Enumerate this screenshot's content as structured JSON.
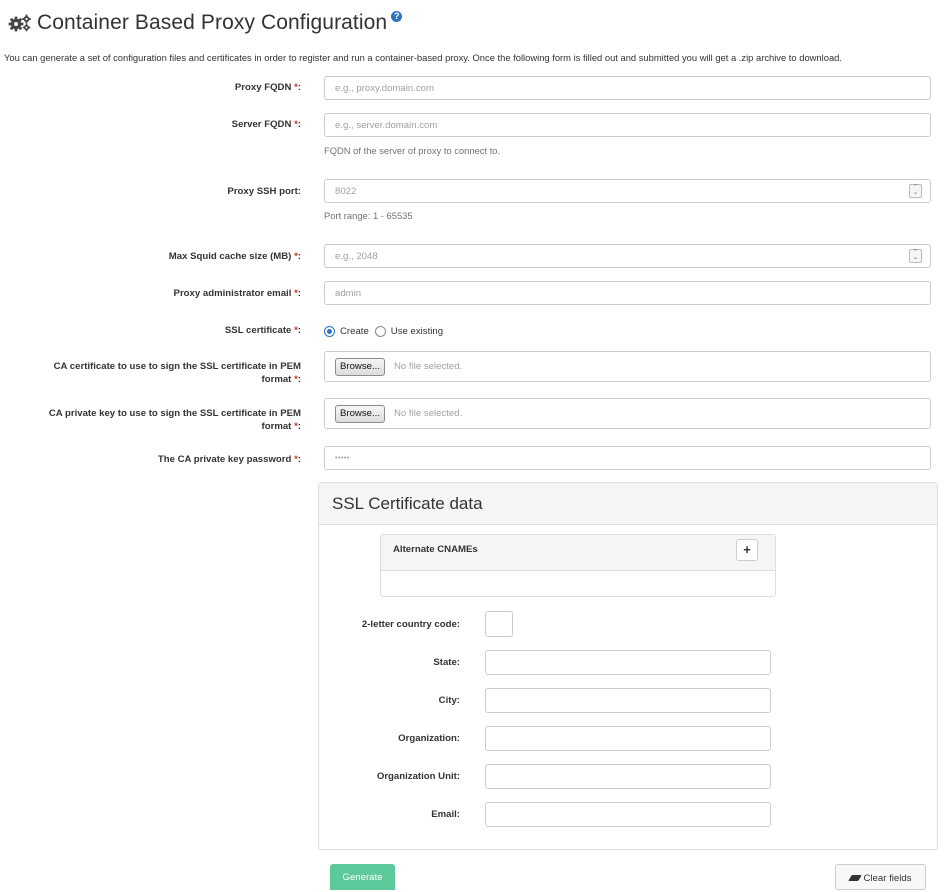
{
  "page": {
    "title": "Container Based Proxy Configuration",
    "help_icon_glyph": "?",
    "description": "You can generate a set of configuration files and certificates in order to register and run a container-based proxy. Once the following form is filled out and submitted you will get a .zip archive to download."
  },
  "form": {
    "required_marker": "*",
    "proxy_fqdn": {
      "label": "Proxy FQDN",
      "placeholder": "e.g., proxy.domain.com"
    },
    "server_fqdn": {
      "label": "Server FQDN",
      "placeholder": "e.g., server.domain.com",
      "help": "FQDN of the server of proxy to connect to."
    },
    "ssh_port": {
      "label": "Proxy SSH port:",
      "placeholder": "8022",
      "help": "Port range: 1 - 65535"
    },
    "squid_cache": {
      "label": "Max Squid cache size (MB)",
      "placeholder": "e.g., 2048"
    },
    "admin_email": {
      "label": "Proxy administrator email",
      "placeholder": "admin"
    },
    "ssl_certificate": {
      "label": "SSL certificate",
      "options": [
        "Create",
        "Use existing"
      ],
      "selected": "Create"
    },
    "ca_cert": {
      "label_line1": "CA certificate to use to sign the SSL certificate in PEM",
      "label_line2": "format",
      "button": "Browse...",
      "status": "No file selected."
    },
    "ca_key": {
      "label_line1": "CA private key to use to sign the SSL certificate in PEM",
      "label_line2": "format",
      "button": "Browse...",
      "status": "No file selected."
    },
    "ca_password": {
      "label": "The CA private key password",
      "value": "•••••"
    }
  },
  "ssl_panel": {
    "title": "SSL Certificate data",
    "alt_cnames": {
      "title": "Alternate CNAMEs",
      "add_glyph": "+"
    },
    "fields": {
      "country": "2-letter country code:",
      "state": "State:",
      "city": "City:",
      "organization": "Organization:",
      "org_unit": "Organization Unit:",
      "email": "Email:"
    }
  },
  "actions": {
    "generate": "Generate",
    "clear": "Clear fields"
  },
  "colors": {
    "primary": "#2f74c0",
    "success": "#5cc99b",
    "required": "#c9302c"
  }
}
